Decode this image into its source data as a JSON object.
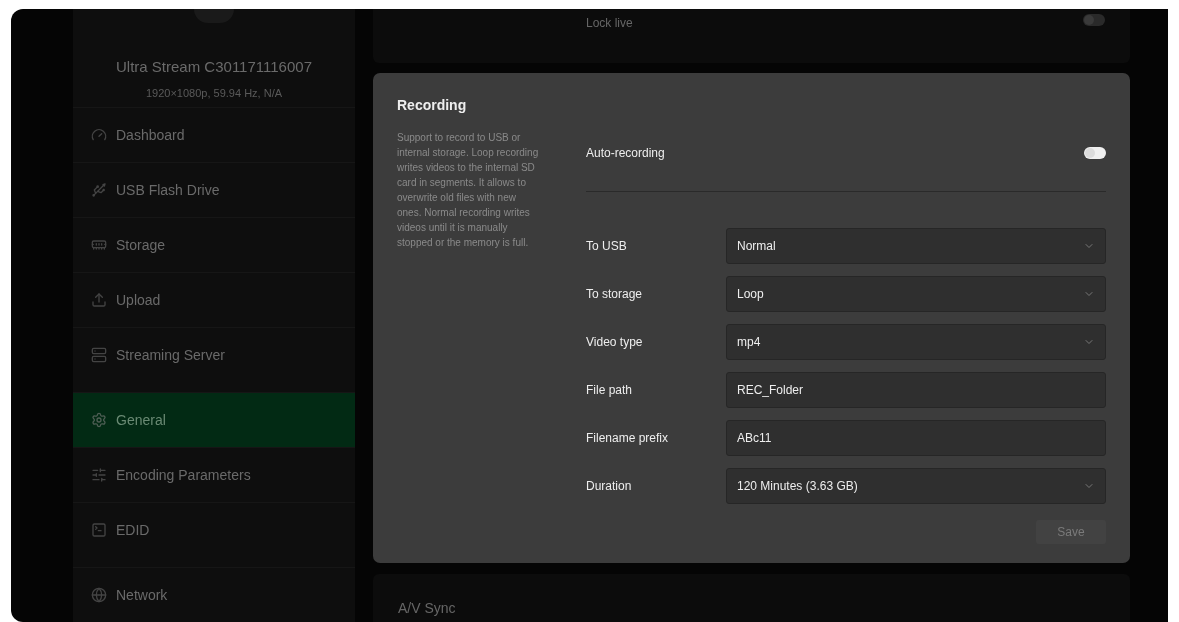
{
  "device": {
    "name": "Ultra Stream C301171116007",
    "signal": "1920×1080p, 59.94 Hz, N/A"
  },
  "sidebar": {
    "groups": [
      [
        {
          "label": "Dashboard",
          "selected": false
        },
        {
          "label": "USB Flash Drive",
          "selected": false
        },
        {
          "label": "Storage",
          "selected": false
        },
        {
          "label": "Upload",
          "selected": false
        },
        {
          "label": "Streaming Server",
          "selected": false
        }
      ],
      [
        {
          "label": "General",
          "selected": true
        },
        {
          "label": "Encoding Parameters",
          "selected": false
        },
        {
          "label": "EDID",
          "selected": false
        }
      ],
      [
        {
          "label": "Network",
          "selected": false
        }
      ]
    ]
  },
  "background_cards": {
    "lock_live": {
      "label": "Lock live",
      "on": false
    },
    "av_sync": {
      "title": "A/V Sync"
    }
  },
  "dialog": {
    "title": "Recording",
    "description": "Support to record to USB or internal storage. Loop recording writes videos to the internal SD card in segments. It allows to overwrite old files with new ones. Normal recording writes videos until it is manually stopped or the memory is full.",
    "auto_recording": {
      "label": "Auto-recording",
      "on": false
    },
    "fields": [
      {
        "label": "To USB",
        "kind": "select",
        "value": "Normal"
      },
      {
        "label": "To storage",
        "kind": "select",
        "value": "Loop"
      },
      {
        "label": "Video type",
        "kind": "select",
        "value": "mp4"
      },
      {
        "label": "File path",
        "kind": "text",
        "value": "REC_Folder"
      },
      {
        "label": "Filename prefix",
        "kind": "text",
        "value": "ABc11"
      },
      {
        "label": "Duration",
        "kind": "select",
        "value": "120 Minutes (3.63 GB)"
      }
    ],
    "save_button": {
      "label": "Save",
      "disabled": true
    }
  }
}
